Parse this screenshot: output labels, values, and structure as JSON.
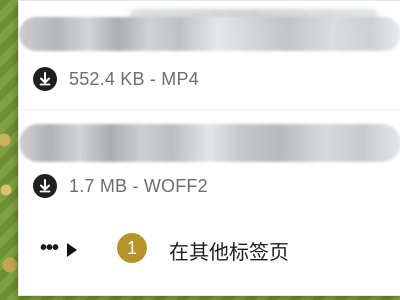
{
  "colors": {
    "panel_bg": "#ffffff",
    "meta_text": "#6e6e6e",
    "download_icon_bg": "#1f1f1f",
    "badge_bg": "#b7932b"
  },
  "downloads": [
    {
      "icon": "download-icon",
      "meta": "552.4 KB - MP4"
    },
    {
      "icon": "download-icon",
      "meta": "1.7 MB - WOFF2"
    }
  ],
  "footer": {
    "more_icon": "ellipsis-icon",
    "play_icon": "play-triangle-icon",
    "count": "1",
    "other_tabs_label": "在其他标签页"
  }
}
